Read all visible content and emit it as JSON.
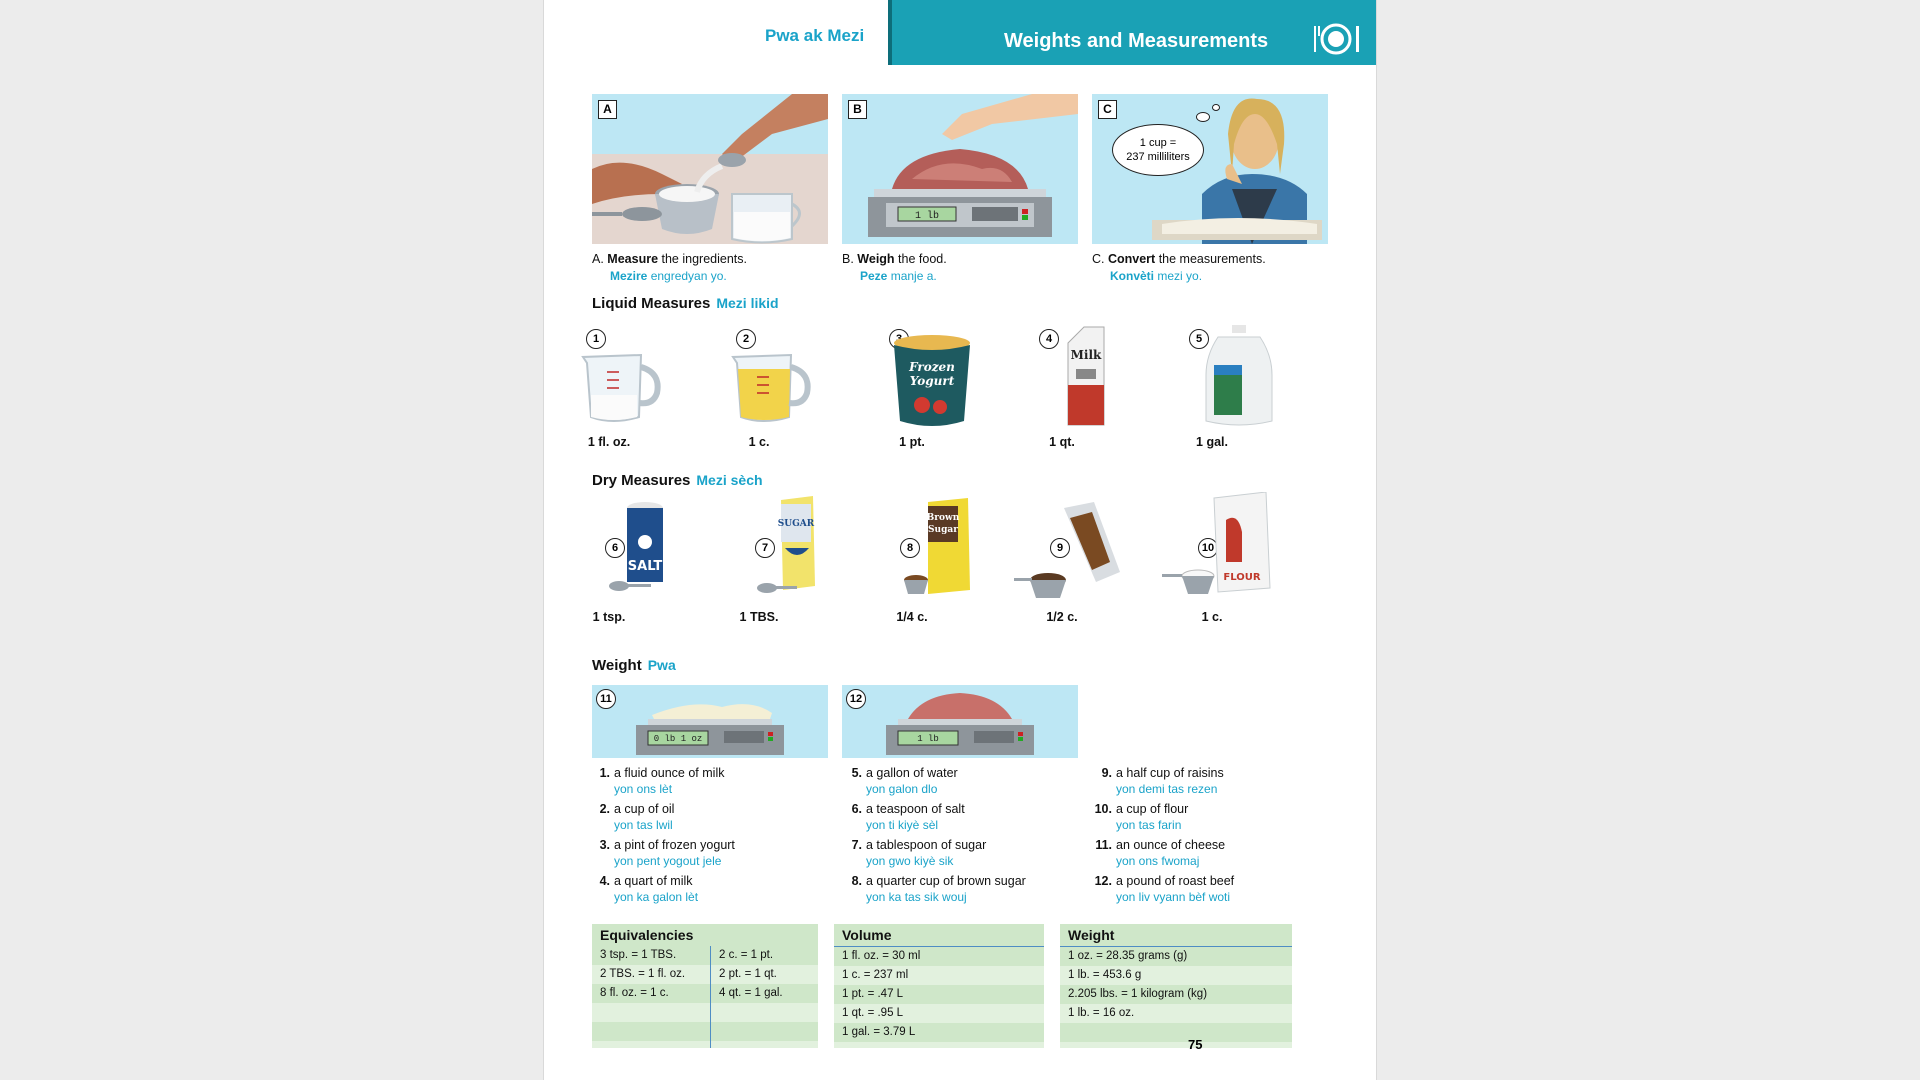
{
  "header": {
    "left_title": "Pwa ak Mezi",
    "title": "Weights and Measurements",
    "accent_color": "#1aa1b5",
    "icon": "plate-utensils-icon"
  },
  "photos": [
    {
      "letter": "A",
      "verb": "Measure",
      "rest": " the ingredients.",
      "trans_verb": "Mezire",
      "trans_rest": " engredyan yo."
    },
    {
      "letter": "B",
      "verb": "Weigh",
      "rest": " the food.",
      "trans_verb": "Peze",
      "trans_rest": " manje a.",
      "scale_display": "1 lb"
    },
    {
      "letter": "C",
      "verb": "Convert",
      "rest": " the measurements.",
      "trans_verb": "Konvèti",
      "trans_rest": " mezi yo.",
      "bubble_line1": "1 cup =",
      "bubble_line2": "237 milliliters"
    }
  ],
  "liquid": {
    "title": "Liquid Measures",
    "translation": "Mezi likid",
    "items": [
      {
        "num": "1",
        "label": "1 fl. oz.",
        "icon": "measuring-cup-icon"
      },
      {
        "num": "2",
        "label": "1 c.",
        "icon": "measuring-cup-oil-icon"
      },
      {
        "num": "3",
        "label": "1 pt.",
        "icon": "frozen-yogurt-carton-icon",
        "text1": "Frozen",
        "text2": "Yogurt"
      },
      {
        "num": "4",
        "label": "1 qt.",
        "icon": "milk-carton-icon",
        "text1": "Milk"
      },
      {
        "num": "5",
        "label": "1 gal.",
        "icon": "water-jug-icon"
      }
    ]
  },
  "dry": {
    "title": "Dry Measures",
    "translation": "Mezi sèch",
    "items": [
      {
        "num": "6",
        "label": "1 tsp.",
        "icon": "salt-container-icon",
        "text1": "SALT"
      },
      {
        "num": "7",
        "label": "1 TBS.",
        "icon": "sugar-box-icon",
        "text1": "SUGAR"
      },
      {
        "num": "8",
        "label": "1/4 c.",
        "icon": "brown-sugar-box-icon",
        "text1": "Brown",
        "text2": "Sugar"
      },
      {
        "num": "9",
        "label": "1/2 c.",
        "icon": "raisins-bag-icon"
      },
      {
        "num": "10",
        "label": "1 c.",
        "icon": "flour-bag-icon",
        "text1": "FLOUR"
      }
    ]
  },
  "weight": {
    "title": "Weight",
    "translation": "Pwa",
    "items": [
      {
        "num": "11",
        "display": "0 lb 1 oz"
      },
      {
        "num": "12",
        "display": "1 lb"
      }
    ]
  },
  "vocab": [
    [
      {
        "n": "1.",
        "en": "a fluid ounce of milk",
        "ht": "yon ons lèt"
      },
      {
        "n": "2.",
        "en": "a cup of oil",
        "ht": "yon tas lwil"
      },
      {
        "n": "3.",
        "en": "a pint of frozen yogurt",
        "ht": "yon pent yogout jele"
      },
      {
        "n": "4.",
        "en": "a quart of milk",
        "ht": "yon ka galon lèt"
      }
    ],
    [
      {
        "n": "5.",
        "en": "a gallon of water",
        "ht": "yon galon dlo"
      },
      {
        "n": "6.",
        "en": "a teaspoon of salt",
        "ht": "yon ti kiyè sèl"
      },
      {
        "n": "7.",
        "en": "a tablespoon of sugar",
        "ht": "yon gwo kiyè sik"
      },
      {
        "n": "8.",
        "en": "a quarter cup of brown sugar",
        "ht": "yon ka tas sik wouj"
      }
    ],
    [
      {
        "n": "9.",
        "en": "a half cup of raisins",
        "ht": "yon demi tas rezen"
      },
      {
        "n": "10.",
        "en": "a cup of flour",
        "ht": "yon tas farin"
      },
      {
        "n": "11.",
        "en": "an ounce of cheese",
        "ht": "yon ons fwomaj"
      },
      {
        "n": "12.",
        "en": "a pound of roast beef",
        "ht": "yon liv vyann bèf woti"
      }
    ]
  ],
  "tables": {
    "equivalencies": {
      "title": "Equivalencies",
      "left": [
        "3 tsp. = 1 TBS.",
        "2 TBS. = 1 fl. oz.",
        "8 fl. oz. = 1 c.",
        "",
        ""
      ],
      "right": [
        "2 c. = 1 pt.",
        "2 pt. = 1 qt.",
        "4 qt. = 1 gal.",
        "",
        ""
      ]
    },
    "volume": {
      "title": "Volume",
      "rows": [
        "1 fl. oz. = 30 ml",
        "1 c. = 237 ml",
        "1 pt. = .47 L",
        "1 qt. = .95 L",
        "1 gal. = 3.79 L"
      ]
    },
    "weight": {
      "title": "Weight",
      "rows": [
        "1 oz. = 28.35 grams (g)",
        "1 lb. = 453.6 g",
        "2.205 lbs. = 1 kilogram (kg)",
        "1 lb. = 16 oz.",
        ""
      ]
    }
  },
  "page_number": "75"
}
